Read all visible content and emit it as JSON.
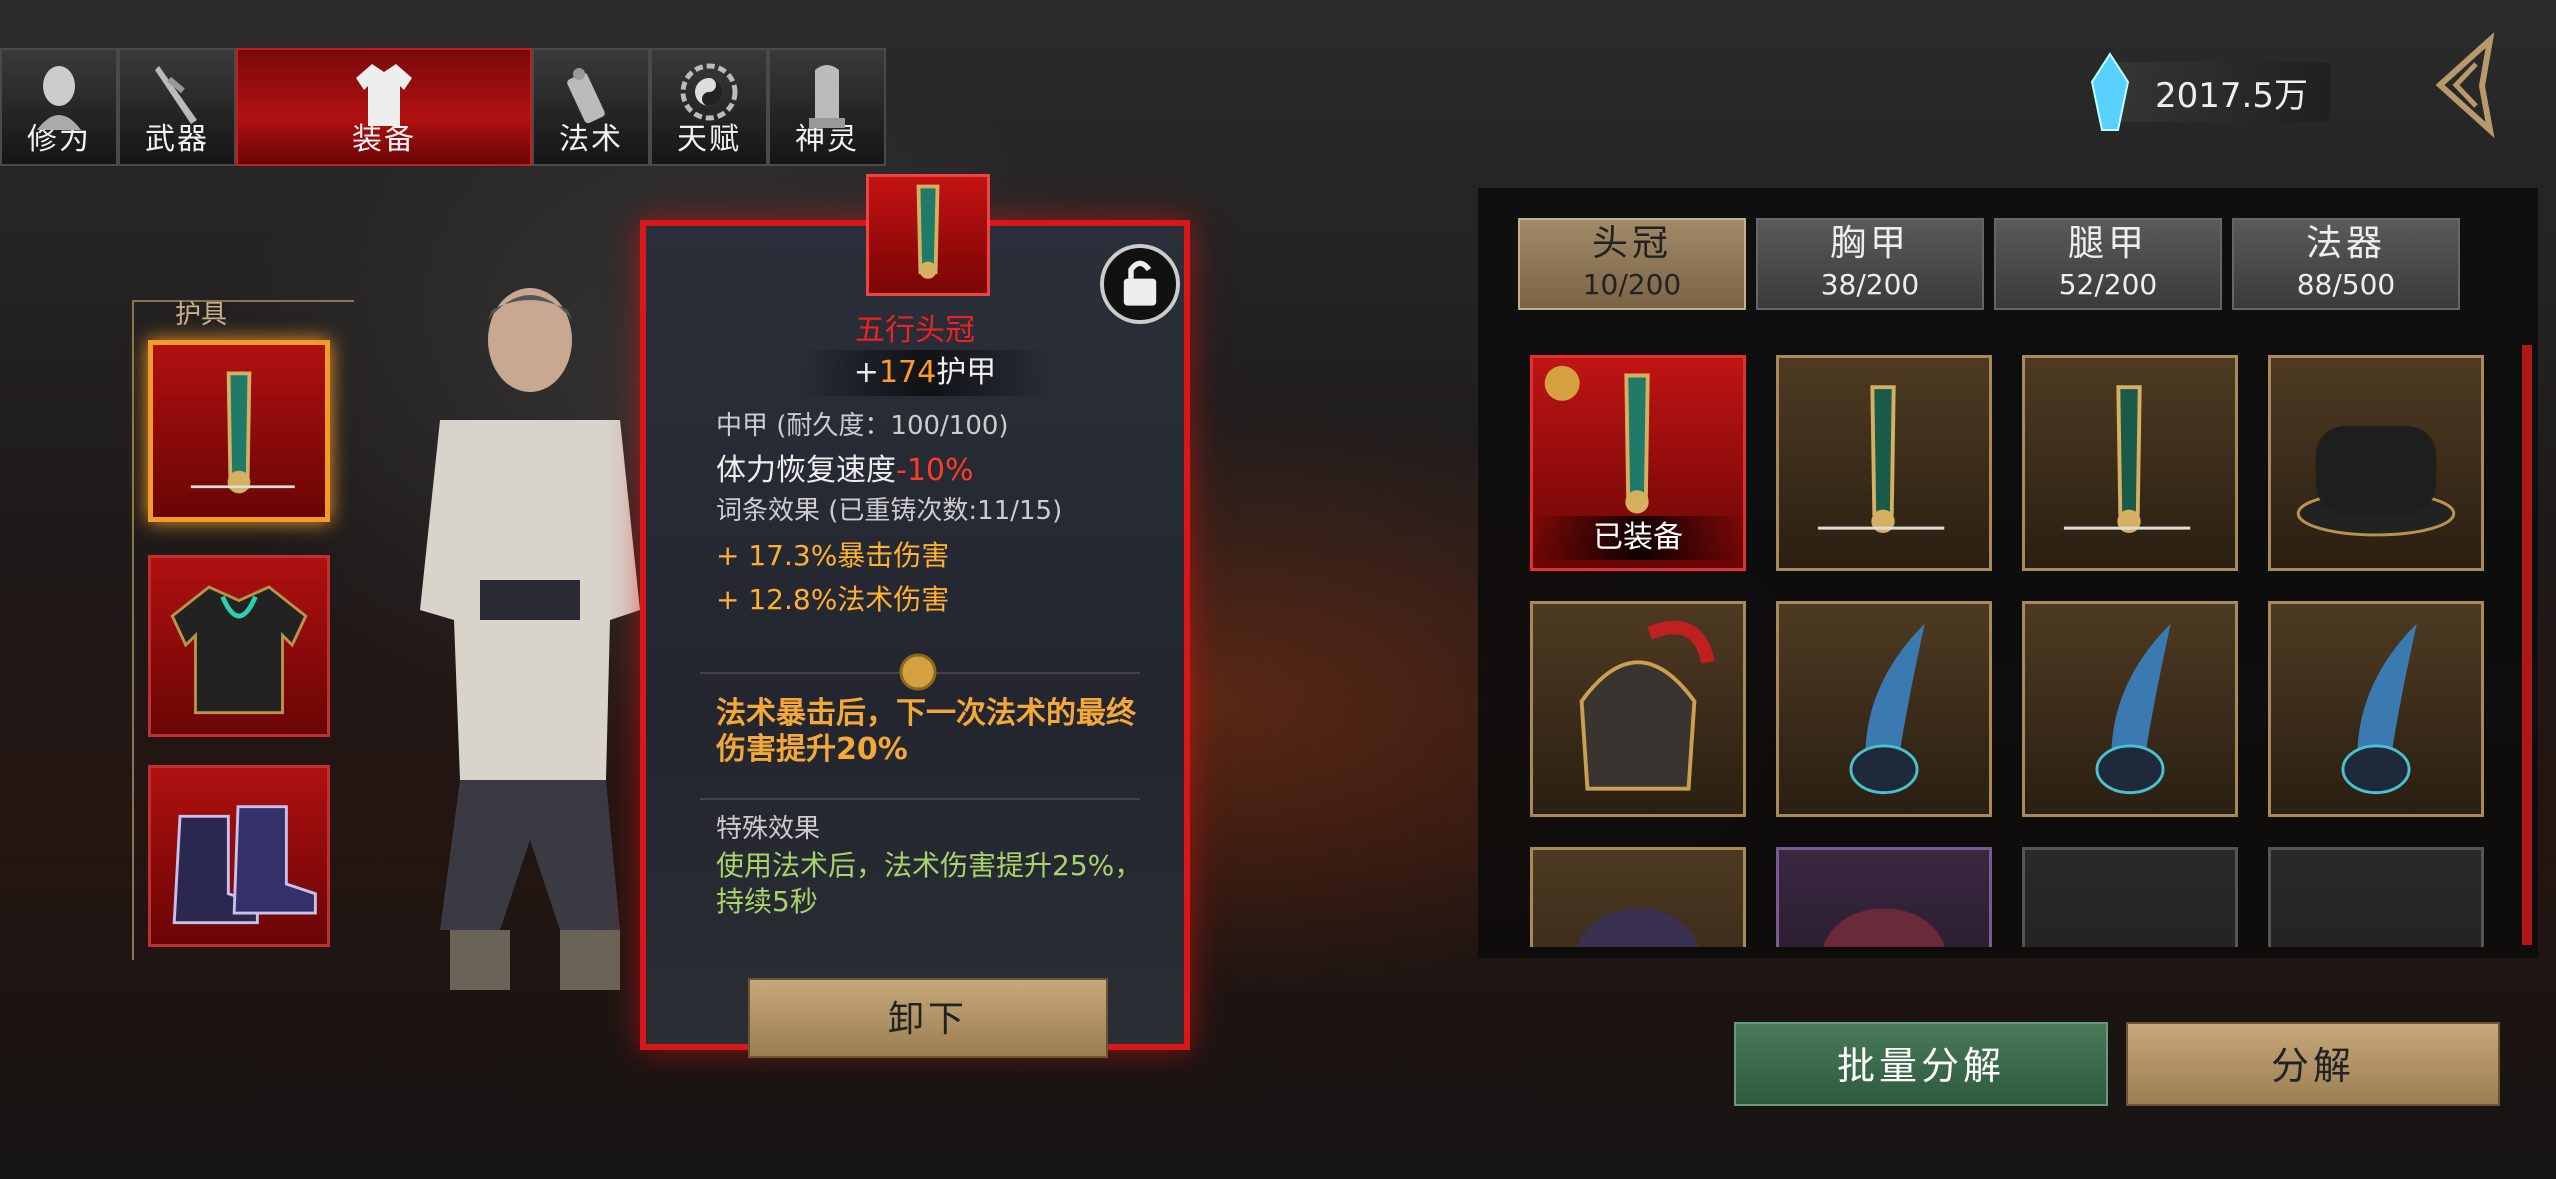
{
  "nav": {
    "tabs": [
      {
        "label": "修为",
        "icon": "meditation-head-icon"
      },
      {
        "label": "武器",
        "icon": "sword-icon"
      },
      {
        "label": "装备",
        "icon": "robe-icon",
        "active": true
      },
      {
        "label": "法术",
        "icon": "scroll-icon"
      },
      {
        "label": "天赋",
        "icon": "yinyang-bagua-icon"
      },
      {
        "label": "神灵",
        "icon": "tablet-icon"
      }
    ]
  },
  "currency": {
    "amount": "2017.5万",
    "icon": "blue-crystal-icon"
  },
  "armor": {
    "title": "护具",
    "slots": [
      {
        "icon": "helmet-crown-icon",
        "selected": true
      },
      {
        "icon": "chest-robe-icon"
      },
      {
        "icon": "boots-icon"
      }
    ]
  },
  "detail": {
    "name": "五行头冠",
    "armor_prefix": "+",
    "armor_value": "174",
    "armor_suffix": "护甲",
    "type_line": "中甲  (耐久度：100/100)",
    "stamina_label": "体力恢复速度",
    "stamina_value": "-10%",
    "affix_title": "词条效果  (已重铸次数:11/15)",
    "affix1": "+ 17.3%暴击伤害",
    "affix2": "+ 12.8%法术伤害",
    "set_effect": "法术暴击后，下一次法术的最终伤害提升20%",
    "special_title": "特殊效果",
    "special_effect": "使用法术后，法术伤害提升25%，持续5秒",
    "unequip_label": "卸下"
  },
  "categories": [
    {
      "name": "头冠",
      "count": "10/200",
      "active": true
    },
    {
      "name": "胸甲",
      "count": "38/200"
    },
    {
      "name": "腿甲",
      "count": "52/200"
    },
    {
      "name": "法器",
      "count": "88/500"
    }
  ],
  "inventory": {
    "equipped_label": "已装备",
    "items": [
      {
        "kind": "equipped",
        "icon": "jade-crown-icon"
      },
      {
        "kind": "gold",
        "icon": "jade-crown-icon"
      },
      {
        "kind": "gold",
        "icon": "jade-crown-icon"
      },
      {
        "kind": "gold",
        "icon": "black-hat-icon"
      },
      {
        "kind": "gold",
        "icon": "plumed-helmet-icon"
      },
      {
        "kind": "gold",
        "icon": "feather-headdress-icon"
      },
      {
        "kind": "gold",
        "icon": "feather-headdress-icon"
      },
      {
        "kind": "gold",
        "icon": "feather-headdress-icon"
      },
      {
        "kind": "gold",
        "icon": "turban-icon"
      },
      {
        "kind": "purple",
        "icon": "embroidered-cap-icon"
      },
      {
        "kind": "empty"
      },
      {
        "kind": "empty"
      }
    ]
  },
  "actions": {
    "batch_decompose": "批量分解",
    "decompose": "分解"
  },
  "colors": {
    "accent_red": "#d81818",
    "gold_text": "#f3a838",
    "green_text": "#a7d36a",
    "armor_highlight": "#ff9a2a"
  }
}
